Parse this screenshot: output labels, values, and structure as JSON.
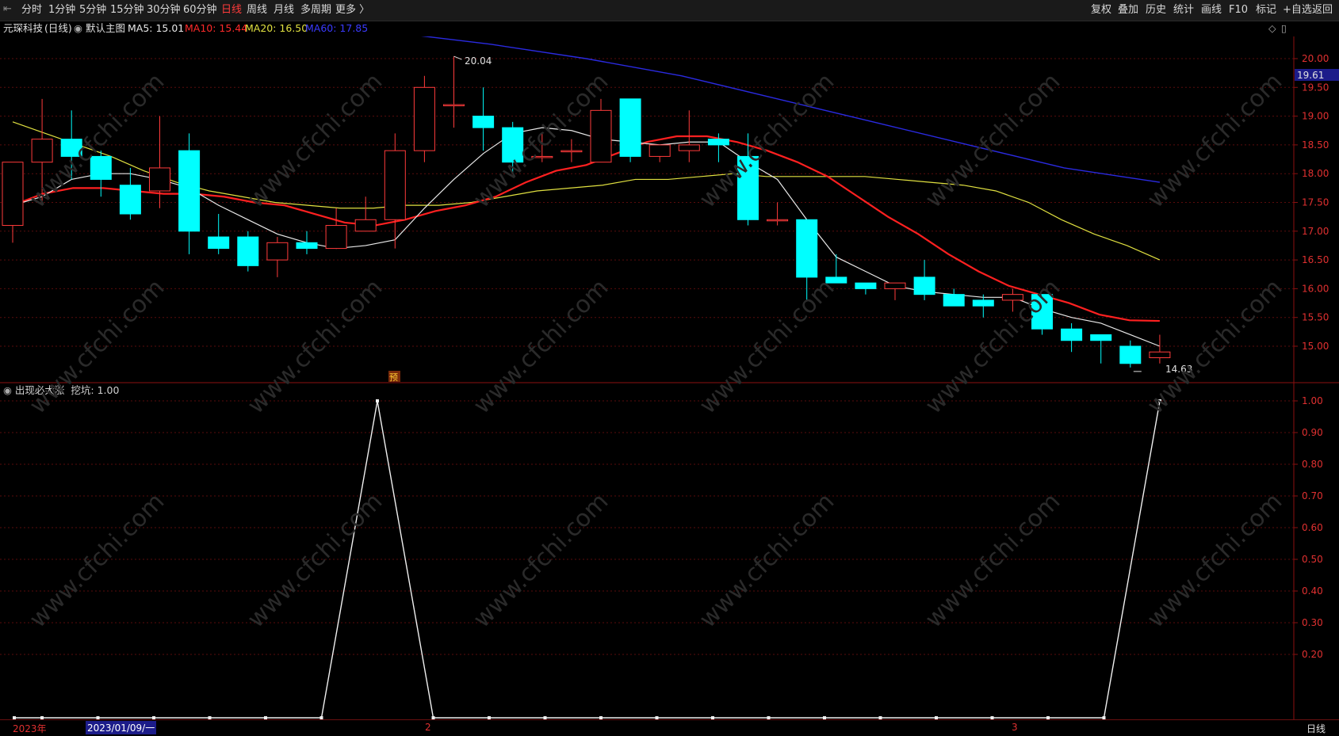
{
  "toolbar": {
    "left_items": [
      "分时",
      "1分钟",
      "5分钟",
      "15分钟",
      "30分钟",
      "60分钟",
      "日线",
      "周线",
      "月线",
      "多周期",
      "更多 〉"
    ],
    "active": "日线",
    "right_items": [
      "复权",
      "叠加",
      "历史",
      "统计",
      "画线",
      "F10",
      "标记",
      "+自选",
      "返回"
    ]
  },
  "info": {
    "stock": "元琛科技",
    "period": "(日线)",
    "main_label": "默认主图",
    "ma5_label": "MA5: 15.01",
    "ma10_label": "MA10: 15.44",
    "ma20_label": "MA20: 16.50",
    "ma60_label": "MA60: 17.85"
  },
  "colors": {
    "ma5": "#e8e8e8",
    "ma10": "#ff2020",
    "ma20": "#e0e040",
    "ma60": "#2a2ae0",
    "up": "#ff3b3b",
    "down": "#00ffff",
    "axis": "#8b1010"
  },
  "price_axis": {
    "ticks": [
      "20.00",
      "19.50",
      "19.00",
      "18.50",
      "18.00",
      "17.50",
      "17.00",
      "16.50",
      "16.00",
      "15.50",
      "15.00"
    ],
    "current_badge": "19.61",
    "high_label": "20.04",
    "low_label": "14.63",
    "marker": "预"
  },
  "indicator": {
    "title": "出现必大涨",
    "value_label": "挖坑: 1.00",
    "ticks": [
      "1.00",
      "0.90",
      "0.80",
      "0.70",
      "0.60",
      "0.50",
      "0.40",
      "0.30",
      "0.20"
    ]
  },
  "bottom": {
    "year": "2023年",
    "cursor_date": "2023/01/09/一",
    "month_2": "2",
    "month_3": "3",
    "period_tag": "日线"
  },
  "watermark": "www.cfchi.com",
  "chart_data": {
    "type": "candlestick",
    "ylim": [
      14.3,
      20.6
    ],
    "candles": [
      {
        "o": 17.1,
        "h": 17.9,
        "l": 16.8,
        "c": 18.2
      },
      {
        "o": 18.2,
        "h": 19.3,
        "l": 17.5,
        "c": 18.6
      },
      {
        "o": 18.6,
        "h": 19.1,
        "l": 17.9,
        "c": 18.3
      },
      {
        "o": 18.3,
        "h": 18.4,
        "l": 17.6,
        "c": 17.9
      },
      {
        "o": 17.8,
        "h": 18.1,
        "l": 17.2,
        "c": 17.3
      },
      {
        "o": 17.7,
        "h": 19.0,
        "l": 17.4,
        "c": 18.1
      },
      {
        "o": 18.4,
        "h": 18.7,
        "l": 16.6,
        "c": 17.0
      },
      {
        "o": 16.9,
        "h": 17.3,
        "l": 16.6,
        "c": 16.7
      },
      {
        "o": 16.9,
        "h": 17.0,
        "l": 16.3,
        "c": 16.4
      },
      {
        "o": 16.5,
        "h": 16.9,
        "l": 16.2,
        "c": 16.8
      },
      {
        "o": 16.8,
        "h": 17.0,
        "l": 16.6,
        "c": 16.7
      },
      {
        "o": 16.7,
        "h": 17.4,
        "l": 16.7,
        "c": 17.1
      },
      {
        "o": 17.0,
        "h": 17.6,
        "l": 17.0,
        "c": 17.2
      },
      {
        "o": 17.2,
        "h": 18.7,
        "l": 16.7,
        "c": 18.4
      },
      {
        "o": 18.4,
        "h": 19.7,
        "l": 18.2,
        "c": 19.5
      },
      {
        "o": 19.2,
        "h": 20.04,
        "l": 18.8,
        "c": 19.2
      },
      {
        "o": 19.0,
        "h": 19.5,
        "l": 18.4,
        "c": 18.8
      },
      {
        "o": 18.8,
        "h": 18.9,
        "l": 18.0,
        "c": 18.2
      },
      {
        "o": 18.3,
        "h": 18.7,
        "l": 18.2,
        "c": 18.3
      },
      {
        "o": 18.4,
        "h": 18.6,
        "l": 18.2,
        "c": 18.4
      },
      {
        "o": 18.2,
        "h": 19.3,
        "l": 18.2,
        "c": 19.1
      },
      {
        "o": 19.3,
        "h": 19.3,
        "l": 18.2,
        "c": 18.3
      },
      {
        "o": 18.3,
        "h": 18.5,
        "l": 18.2,
        "c": 18.5
      },
      {
        "o": 18.4,
        "h": 19.1,
        "l": 18.2,
        "c": 18.5
      },
      {
        "o": 18.6,
        "h": 18.7,
        "l": 18.2,
        "c": 18.5
      },
      {
        "o": 18.3,
        "h": 18.7,
        "l": 17.1,
        "c": 17.2
      },
      {
        "o": 17.2,
        "h": 17.5,
        "l": 17.1,
        "c": 17.2
      },
      {
        "o": 17.2,
        "h": 17.2,
        "l": 15.8,
        "c": 16.2
      },
      {
        "o": 16.2,
        "h": 16.6,
        "l": 16.1,
        "c": 16.1
      },
      {
        "o": 16.1,
        "h": 16.1,
        "l": 15.9,
        "c": 16.0
      },
      {
        "o": 16.0,
        "h": 16.1,
        "l": 15.8,
        "c": 16.1
      },
      {
        "o": 16.2,
        "h": 16.5,
        "l": 15.8,
        "c": 15.9
      },
      {
        "o": 15.9,
        "h": 16.0,
        "l": 15.7,
        "c": 15.7
      },
      {
        "o": 15.8,
        "h": 15.9,
        "l": 15.5,
        "c": 15.7
      },
      {
        "o": 15.8,
        "h": 16.0,
        "l": 15.6,
        "c": 15.9
      },
      {
        "o": 15.9,
        "h": 15.9,
        "l": 15.2,
        "c": 15.3
      },
      {
        "o": 15.3,
        "h": 15.4,
        "l": 14.9,
        "c": 15.1
      },
      {
        "o": 15.2,
        "h": 15.2,
        "l": 14.7,
        "c": 15.1
      },
      {
        "o": 15.0,
        "h": 15.1,
        "l": 14.63,
        "c": 14.7
      },
      {
        "o": 14.8,
        "h": 15.2,
        "l": 14.7,
        "c": 14.9
      }
    ],
    "ma5": [
      17.45,
      17.6,
      17.9,
      18.0,
      18.0,
      17.9,
      17.75,
      17.45,
      17.2,
      16.95,
      16.8,
      16.7,
      16.75,
      16.85,
      17.4,
      17.9,
      18.35,
      18.7,
      18.8,
      18.75,
      18.6,
      18.55,
      18.5,
      18.55,
      18.55,
      18.2,
      17.9,
      17.2,
      16.55,
      16.3,
      16.05,
      15.95,
      15.9,
      15.85,
      15.85,
      15.65,
      15.5,
      15.4,
      15.2,
      15.0
    ],
    "ma10": [
      17.45,
      17.65,
      17.75,
      17.75,
      17.7,
      17.65,
      17.65,
      17.6,
      17.5,
      17.45,
      17.3,
      17.15,
      17.1,
      17.2,
      17.35,
      17.45,
      17.6,
      17.85,
      18.05,
      18.15,
      18.35,
      18.55,
      18.65,
      18.65,
      18.55,
      18.4,
      18.2,
      17.95,
      17.6,
      17.25,
      16.95,
      16.6,
      16.3,
      16.05,
      15.9,
      15.75,
      15.55,
      15.45,
      15.44
    ],
    "ma20": [
      18.9,
      18.7,
      18.5,
      18.3,
      18.05,
      17.85,
      17.7,
      17.6,
      17.5,
      17.45,
      17.4,
      17.4,
      17.45,
      17.45,
      17.5,
      17.6,
      17.7,
      17.75,
      17.8,
      17.9,
      17.9,
      17.95,
      18.0,
      17.95,
      17.95,
      17.95,
      17.95,
      17.9,
      17.85,
      17.8,
      17.7,
      17.5,
      17.2,
      16.95,
      16.75,
      16.5
    ],
    "ma60": [
      20.45,
      20.55,
      20.6,
      20.55,
      20.45,
      20.25,
      20.0,
      19.7,
      19.3,
      18.9,
      18.5,
      18.1,
      17.85
    ],
    "indicator_values": [
      0,
      0,
      0,
      0,
      0,
      0,
      1,
      0,
      0,
      0,
      0,
      0,
      0,
      0,
      0,
      0,
      0,
      0,
      0,
      0,
      1
    ]
  }
}
